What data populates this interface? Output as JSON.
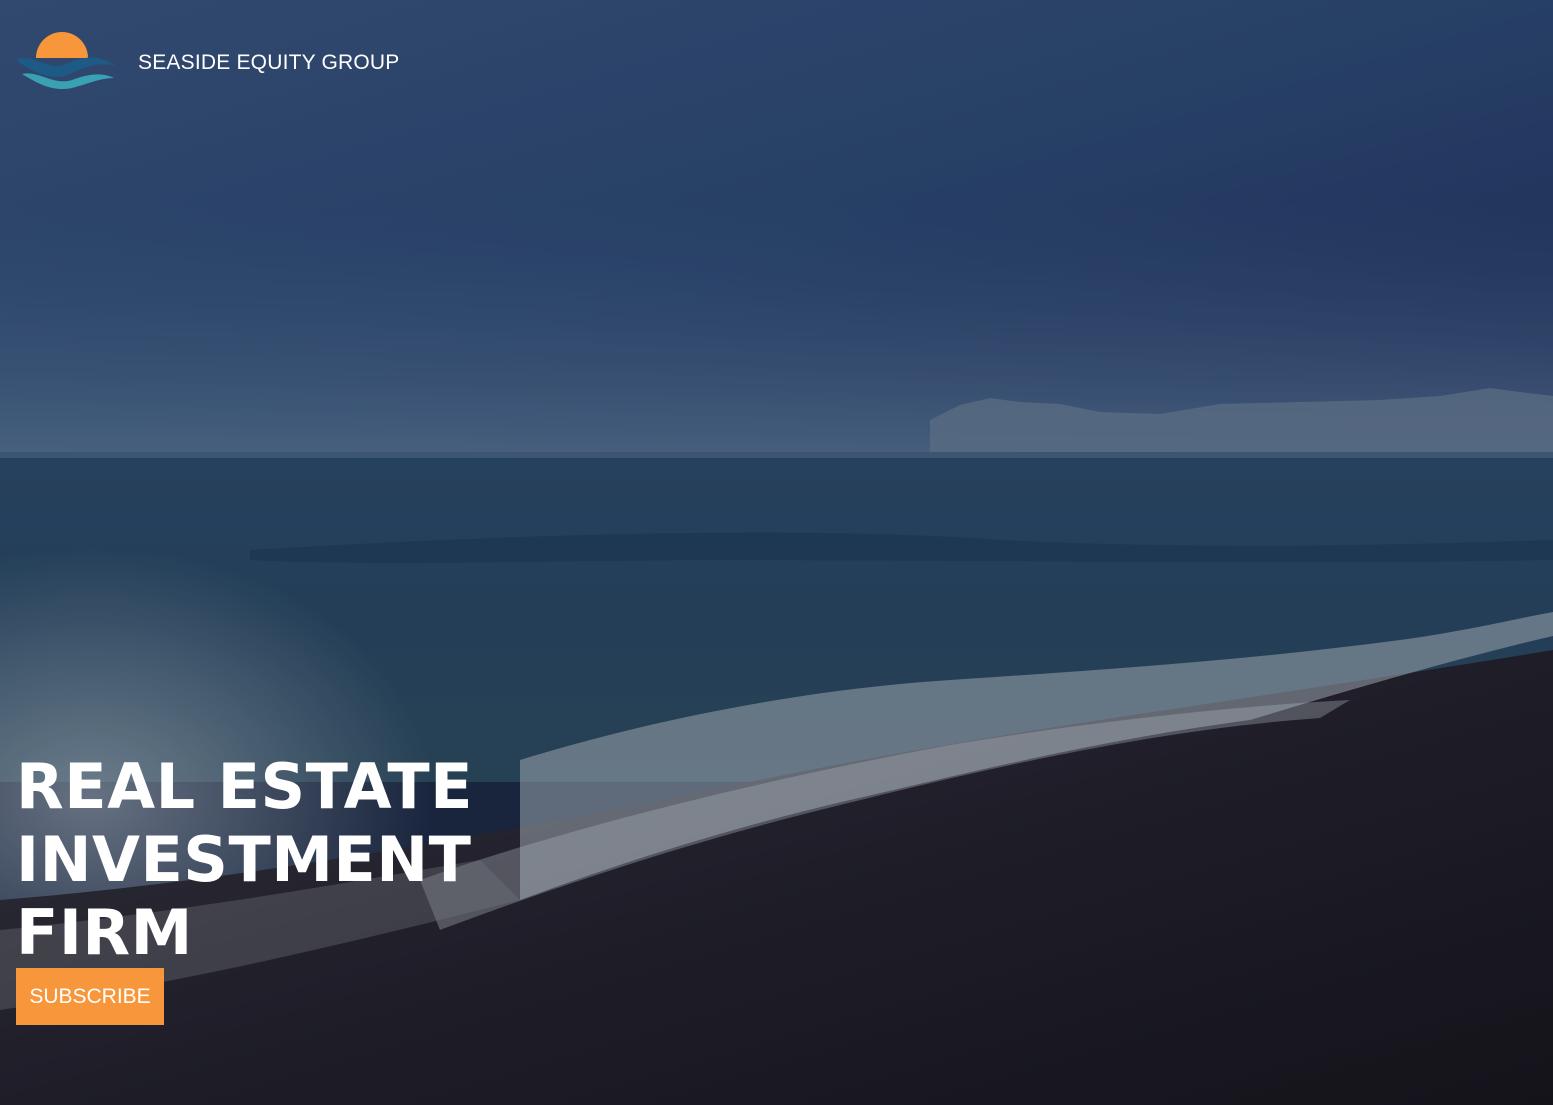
{
  "brand": {
    "name": "SEASIDE EQUITY GROUP",
    "logo_icon": "sun-over-waves-logo"
  },
  "hero": {
    "heading_lines": [
      "REAL ESTATE",
      "INVESTMENT",
      "FIRM"
    ],
    "subscribe_label": "SUBSCRIBE",
    "background": "beach-ocean-horizon-photo"
  },
  "colors": {
    "accent": "#f7963a",
    "text": "#ffffff",
    "sky_dark": "#22305f",
    "sky_light": "#4d6a8c",
    "sea": "#2a4a68",
    "sand": "#1d1a20"
  }
}
